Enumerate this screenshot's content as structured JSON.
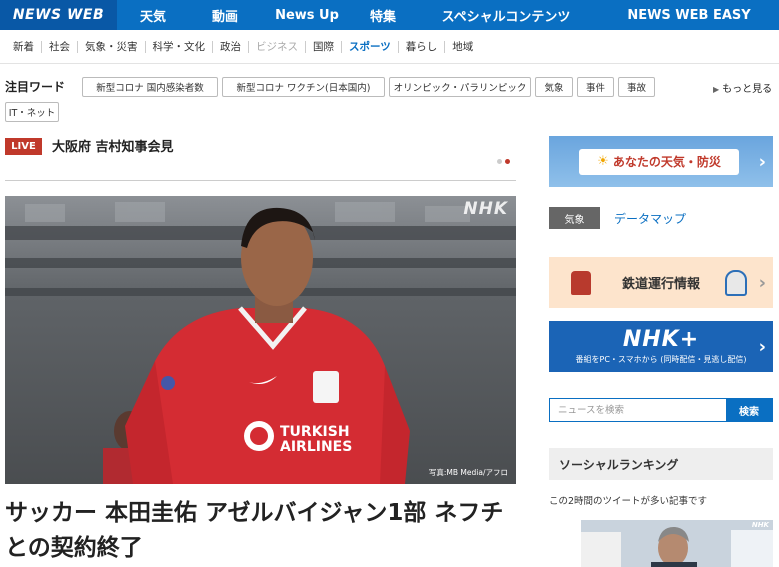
{
  "nav": {
    "logo": "NEWS WEB",
    "items": [
      "天気",
      "動画",
      "News Up",
      "特集",
      "スペシャルコンテンツ",
      "NEWS WEB EASY"
    ]
  },
  "categories": [
    {
      "label": "新着",
      "state": "normal"
    },
    {
      "label": "社会",
      "state": "normal"
    },
    {
      "label": "気象・災害",
      "state": "normal"
    },
    {
      "label": "科学・文化",
      "state": "normal"
    },
    {
      "label": "政治",
      "state": "normal"
    },
    {
      "label": "ビジネス",
      "state": "dim"
    },
    {
      "label": "国際",
      "state": "normal"
    },
    {
      "label": "スポーツ",
      "state": "active"
    },
    {
      "label": "暮らし",
      "state": "normal"
    },
    {
      "label": "地域",
      "state": "normal"
    }
  ],
  "attention": {
    "label": "注目ワード",
    "tags": [
      "新型コロナ 国内感染者数",
      "新型コロナ ワクチン(日本国内)",
      "オリンピック・パラリンピック",
      "気象",
      "事件",
      "事故",
      "IT・ネット"
    ],
    "more": "もっと見る"
  },
  "live": {
    "badge": "LIVE",
    "title": "大阪府 吉村知事会見"
  },
  "hero": {
    "watermark": "NHK",
    "credit": "写真:MB Media/アフロ",
    "jersey_sponsor": "TURKISH AIRLINES"
  },
  "headline": "サッカー 本田圭佑 アゼルバイジャン1部 ネフチとの契約終了",
  "sidebar": {
    "weather_banner": "あなたの天気・防災",
    "weather_badge": "気象",
    "data_map": "データマップ",
    "rail_banner": "鉄道運行情報",
    "nhkplus_title": "NHK+",
    "nhkplus_sub": "番組をPC・スマホから (同時配信・見逃し配信)",
    "search_placeholder": "ニュースを検索",
    "search_button": "検索",
    "social_title": "ソーシャルランキング",
    "social_sub": "この2時間のツイートが多い記事です",
    "thumb_watermark": "NHK"
  },
  "colors": {
    "nav_blue": "#0a6fc2",
    "logo_blue": "#0958a6",
    "live_red": "#c0392b",
    "active_category": "#0a6fc2"
  },
  "icons": {
    "more": "triangle-right",
    "banner_chevron": "chevron-right",
    "weather": "sun-cloud"
  }
}
